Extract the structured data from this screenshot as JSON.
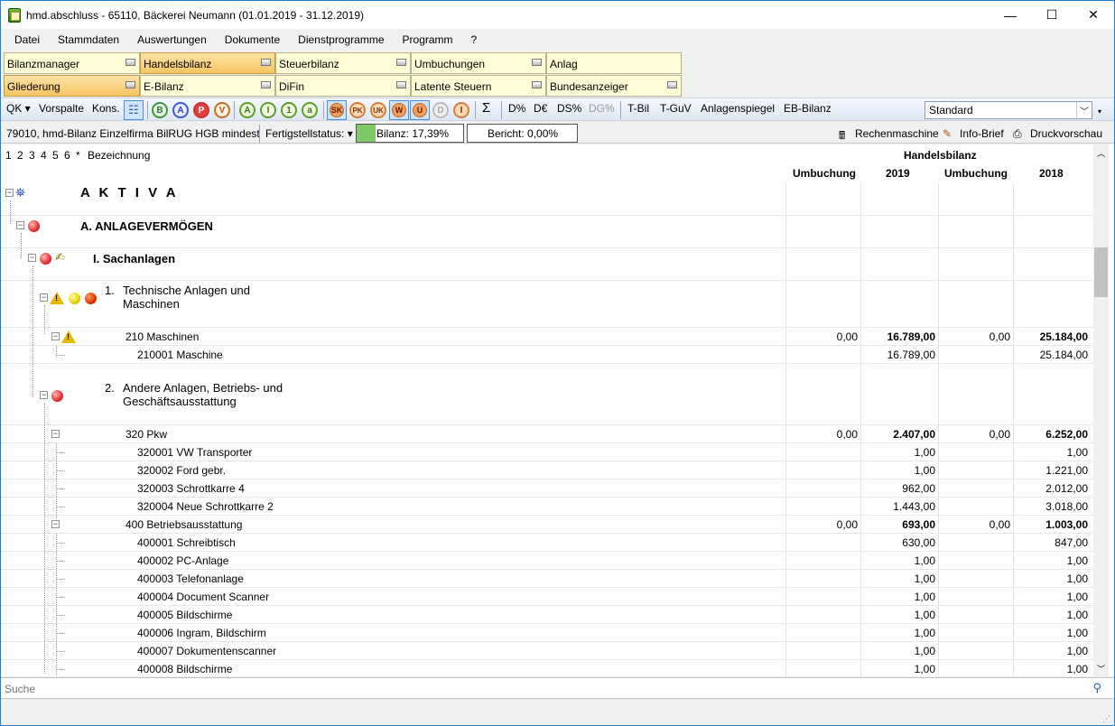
{
  "window": {
    "title": "hmd.abschluss - 65110, Bäckerei Neumann (01.01.2019 - 31.12.2019)",
    "min": "—",
    "max": "☐",
    "close": "✕"
  },
  "menu": [
    "Datei",
    "Stammdaten",
    "Auswertungen",
    "Dokumente",
    "Dienstprogramme",
    "Programm",
    "?"
  ],
  "tabs_row1": [
    "Bilanzmanager",
    "Handelsbilanz",
    "Steuerbilanz",
    "Umbuchungen",
    "Anlag"
  ],
  "tabs_row2": [
    "Gliederung",
    "E-Bilanz",
    "DiFin",
    "Latente Steuern",
    "Bundesanzeiger"
  ],
  "toolbar": {
    "qk": "QK",
    "vorspalte": "Vorspalte",
    "kons": "Kons.",
    "circles": [
      "B",
      "A",
      "P",
      "V",
      "A",
      "I",
      "1",
      "a"
    ],
    "squares": [
      "SK",
      "PK",
      "UK",
      "W",
      "U",
      "D",
      "I"
    ],
    "sigma": "Σ",
    "dp": "D%",
    "de": "D€",
    "dsp": "DS%",
    "dgp": "DG%",
    "tbil": "T-Bil",
    "tguv": "T-GuV",
    "anlagenspiegel": "Anlagenspiegel",
    "ebilanz": "EB-Bilanz",
    "combo_value": "Standard"
  },
  "status": {
    "schema": "79010, hmd-Bilanz Einzelfirma BilRUG HGB mindest",
    "fertigstell": "Fertigstellstatus:",
    "bilanz": "Bilanz: 17,39%",
    "bilanz_fraction": 0.1739,
    "bericht": "Bericht: 0,00%",
    "rechenmaschine": "Rechenmaschine",
    "infobrief": "Info-Brief",
    "druckvorschau": "Druckvorschau"
  },
  "header": {
    "levels": [
      "1",
      "2",
      "3",
      "4",
      "5",
      "6",
      "*"
    ],
    "bezeichnung": "Bezeichnung",
    "group": "Handelsbilanz",
    "cols": [
      "Umbuchung",
      "2019",
      "Umbuchung",
      "2018"
    ]
  },
  "rows": [
    {
      "label": "A K T I V A",
      "u1": "",
      "v2019": "",
      "u2": "",
      "v2018": ""
    },
    {
      "label": "A.  ANLAGEVERMÖGEN",
      "u1": "",
      "v2019": "",
      "u2": "",
      "v2018": ""
    },
    {
      "label": "I.   Sachanlagen",
      "u1": "",
      "v2019": "",
      "u2": "",
      "v2018": ""
    },
    {
      "num": "1.",
      "label": "Technische Anlagen und",
      "label2": "Maschinen",
      "u1": "",
      "v2019": "",
      "u2": "",
      "v2018": ""
    },
    {
      "label": "210 Maschinen",
      "u1": "0,00",
      "v2019": "16.789,00",
      "u2": "0,00",
      "v2018": "25.184,00"
    },
    {
      "label": "210001 Maschine",
      "u1": "",
      "v2019": "16.789,00",
      "u2": "",
      "v2018": "25.184,00"
    },
    {
      "num": "2.",
      "label": "Andere Anlagen, Betriebs- und",
      "label2": "Geschäftsausstattung",
      "u1": "",
      "v2019": "",
      "u2": "",
      "v2018": ""
    },
    {
      "label": "320 Pkw",
      "u1": "0,00",
      "v2019": "2.407,00",
      "u2": "0,00",
      "v2018": "6.252,00"
    },
    {
      "label": "320001 VW Transporter",
      "u1": "",
      "v2019": "1,00",
      "u2": "",
      "v2018": "1,00"
    },
    {
      "label": "320002 Ford gebr.",
      "u1": "",
      "v2019": "1,00",
      "u2": "",
      "v2018": "1.221,00"
    },
    {
      "label": "320003 Schrottkarre 4",
      "u1": "",
      "v2019": "962,00",
      "u2": "",
      "v2018": "2.012,00"
    },
    {
      "label": "320004 Neue Schrottkarre 2",
      "u1": "",
      "v2019": "1.443,00",
      "u2": "",
      "v2018": "3.018,00"
    },
    {
      "label": "400 Betriebsausstattung",
      "u1": "0,00",
      "v2019": "693,00",
      "u2": "0,00",
      "v2018": "1.003,00"
    },
    {
      "label": "400001 Schreibtisch",
      "u1": "",
      "v2019": "630,00",
      "u2": "",
      "v2018": "847,00"
    },
    {
      "label": "400002 PC-Anlage",
      "u1": "",
      "v2019": "1,00",
      "u2": "",
      "v2018": "1,00"
    },
    {
      "label": "400003 Telefonanlage",
      "u1": "",
      "v2019": "1,00",
      "u2": "",
      "v2018": "1,00"
    },
    {
      "label": "400004 Document Scanner",
      "u1": "",
      "v2019": "1,00",
      "u2": "",
      "v2018": "1,00"
    },
    {
      "label": "400005 Bildschirme",
      "u1": "",
      "v2019": "1,00",
      "u2": "",
      "v2018": "1,00"
    },
    {
      "label": "400006 Ingram, Bildschirm",
      "u1": "",
      "v2019": "1,00",
      "u2": "",
      "v2018": "1,00"
    },
    {
      "label": "400007 Dokumentenscanner",
      "u1": "",
      "v2019": "1,00",
      "u2": "",
      "v2018": "1,00"
    },
    {
      "label": "400008 Bildschirme",
      "u1": "",
      "v2019": "1,00",
      "u2": "",
      "v2018": "1,00"
    }
  ],
  "search": {
    "placeholder": "Suche"
  },
  "colors": {
    "accent": "#1883d7",
    "tab_bg": "#fffcd8",
    "tab_active": "#f6c562"
  }
}
